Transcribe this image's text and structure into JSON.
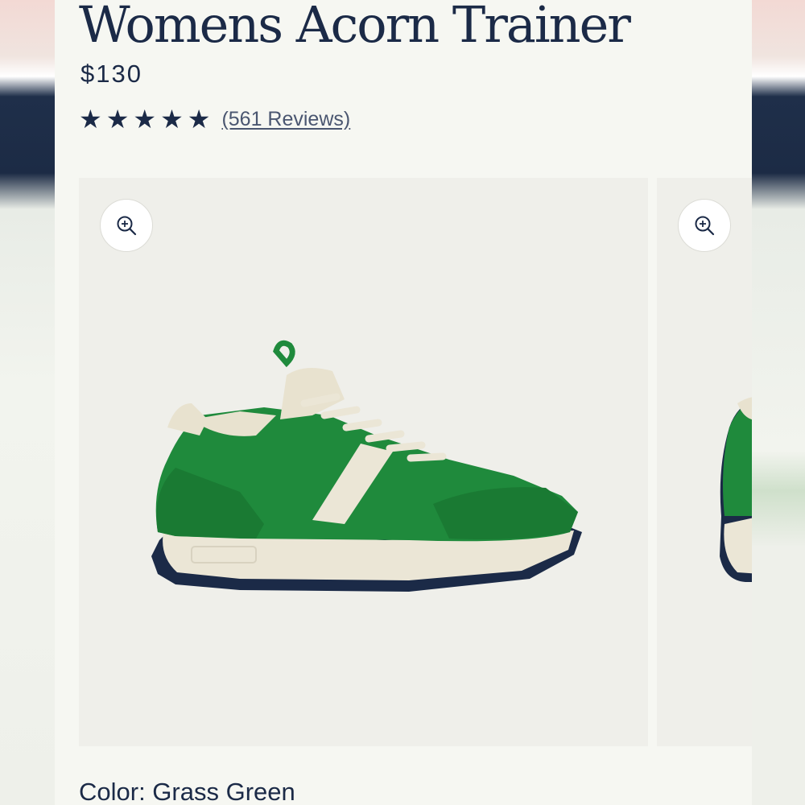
{
  "product": {
    "title": "Womens Acorn Trainer",
    "price": "$130",
    "rating_stars": 5,
    "reviews_label": "(561 Reviews)"
  },
  "gallery": {
    "zoom_icon": "zoom-in-icon",
    "image_subject": "green-suede-sneaker"
  },
  "color": {
    "label": "Color: Grass Green"
  },
  "colors": {
    "text": "#1b2a47",
    "shoe_green": "#1f8a3c",
    "background": "#f6f7f2"
  }
}
